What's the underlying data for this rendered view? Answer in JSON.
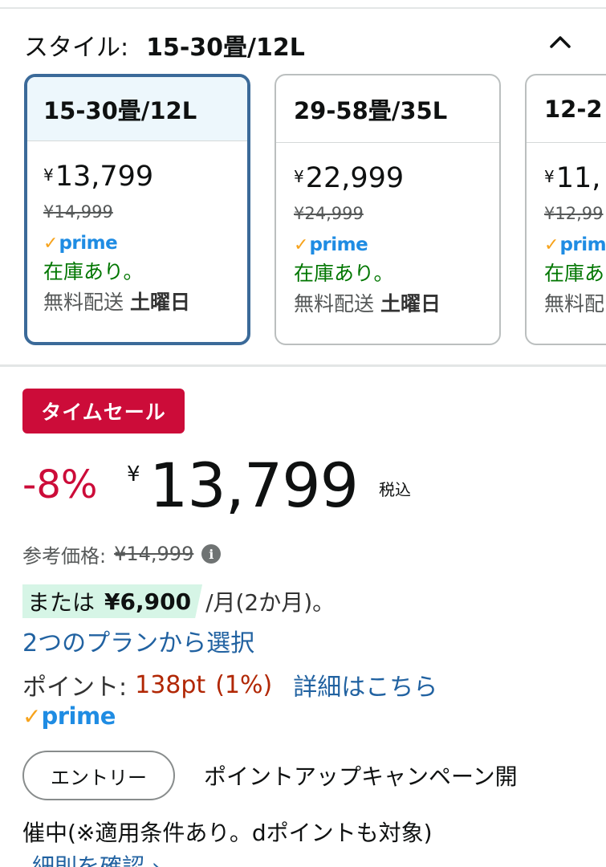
{
  "style_selector": {
    "label": "スタイル:",
    "selected_value": "15-30畳/12L",
    "collapse_icon": "chevron-up-icon"
  },
  "options": [
    {
      "name": "15-30畳/12L",
      "yen": "¥",
      "price": "13,799",
      "list_price": "¥14,999",
      "prime": "prime",
      "stock": "在庫あり。",
      "delivery_label": "無料配送",
      "delivery_day": "土曜日",
      "selected": true
    },
    {
      "name": "29-58畳/35L",
      "yen": "¥",
      "price": "22,999",
      "list_price": "¥24,999",
      "prime": "prime",
      "stock": "在庫あり。",
      "delivery_label": "無料配送",
      "delivery_day": "土曜日",
      "selected": false
    },
    {
      "name": "12-2",
      "yen": "¥",
      "price": "11,",
      "list_price": "¥12,99",
      "prime": "prime",
      "stock": "在庫あ",
      "delivery_label": "無料配",
      "delivery_day": "",
      "selected": false
    }
  ],
  "deal": {
    "badge": "タイムセール",
    "discount": "-8%",
    "yen": "¥",
    "price": "13,799",
    "tax_note": "税込"
  },
  "reference": {
    "label": "参考価格:",
    "price": "¥14,999"
  },
  "installment": {
    "prefix": "または",
    "amount": "¥6,900",
    "suffix": "/月(2か月)。",
    "plan_link": "2つのプランから選択"
  },
  "points": {
    "label": "ポイント:",
    "value": "138pt",
    "percent": "(1%)",
    "details_link": "詳細はこちら"
  },
  "prime_badge": "prime",
  "campaign": {
    "entry_button": "エントリー",
    "text_line1": "ポイントアップキャンペーン開",
    "text_line2": "催中(※適用条件あり。dポイントも対象)",
    "terms_link": "細則を確認 ›"
  },
  "colors": {
    "deal_red": "#cc0c39",
    "link_blue": "#2162a1",
    "stock_green": "#007600",
    "prime_orange": "#f7a31c",
    "prime_blue": "#1f8ce3",
    "install_highlight": "#d6f5e6",
    "selected_border": "#3b6a99"
  }
}
